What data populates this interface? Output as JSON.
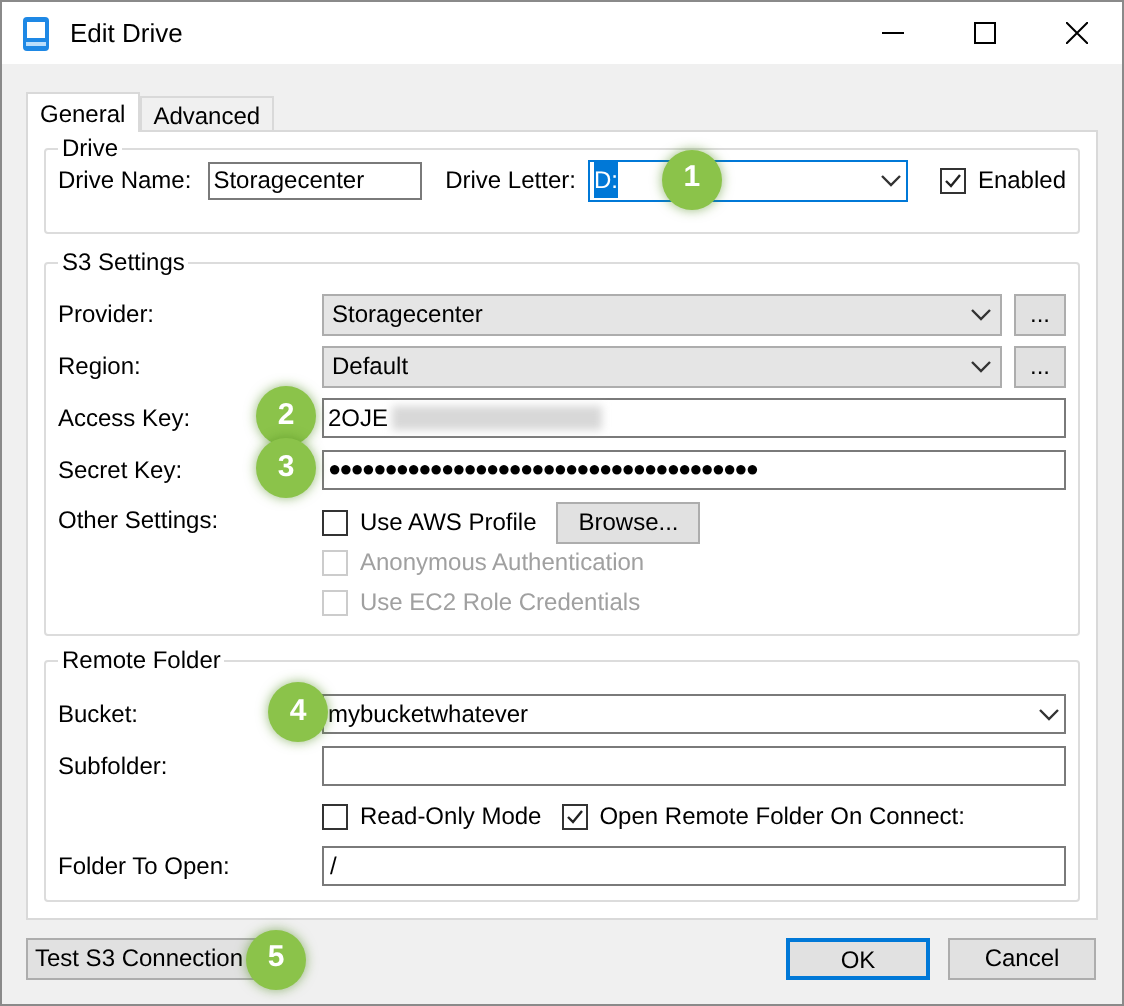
{
  "window": {
    "title": "Edit Drive"
  },
  "tabs": [
    {
      "label": "General",
      "selected": true
    },
    {
      "label": "Advanced",
      "selected": false
    }
  ],
  "drive": {
    "title": "Drive",
    "name_label": "Drive Name:",
    "name_value": "Storagecenter",
    "letter_label": "Drive Letter:",
    "letter_value": "D:",
    "letter_callout": "1",
    "enabled": {
      "label": "Enabled",
      "checked": true
    }
  },
  "s3": {
    "title": "S3 Settings",
    "rows": [
      {
        "kind": "combo",
        "label": "Provider:",
        "value": "Storagecenter",
        "button": "..."
      },
      {
        "kind": "combo",
        "label": "Region:",
        "value": "Default",
        "button": "..."
      },
      {
        "kind": "redacted",
        "label": "Access Key:",
        "value": "2OJE",
        "callout": "2"
      },
      {
        "kind": "text",
        "label": "Secret Key:",
        "value": "●●●●●●●●●●●●●●●●●●●●●●●●●●●●●●●●●●●●●●",
        "callout": "3"
      }
    ],
    "other_label": "Other Settings:",
    "options": [
      {
        "label": "Use AWS Profile",
        "checked": false,
        "disabled": false,
        "button": "Browse..."
      },
      {
        "label": "Anonymous Authentication",
        "checked": false,
        "disabled": true
      },
      {
        "label": "Use EC2 Role Credentials",
        "checked": false,
        "disabled": true
      }
    ]
  },
  "remote": {
    "title": "Remote Folder",
    "bucket_label": "Bucket:",
    "bucket_value": "mybucketwhatever",
    "bucket_callout": "4",
    "subfolder_label": "Subfolder:",
    "options": [
      {
        "label": "Read-Only Mode",
        "checked": false
      },
      {
        "label": "Open Remote Folder On Connect:",
        "checked": true
      }
    ],
    "open_label": "Folder To Open:",
    "open_value": "/"
  },
  "buttons": {
    "test": "Test S3 Connection",
    "test_callout": "5",
    "ok": "OK",
    "cancel": "Cancel"
  }
}
